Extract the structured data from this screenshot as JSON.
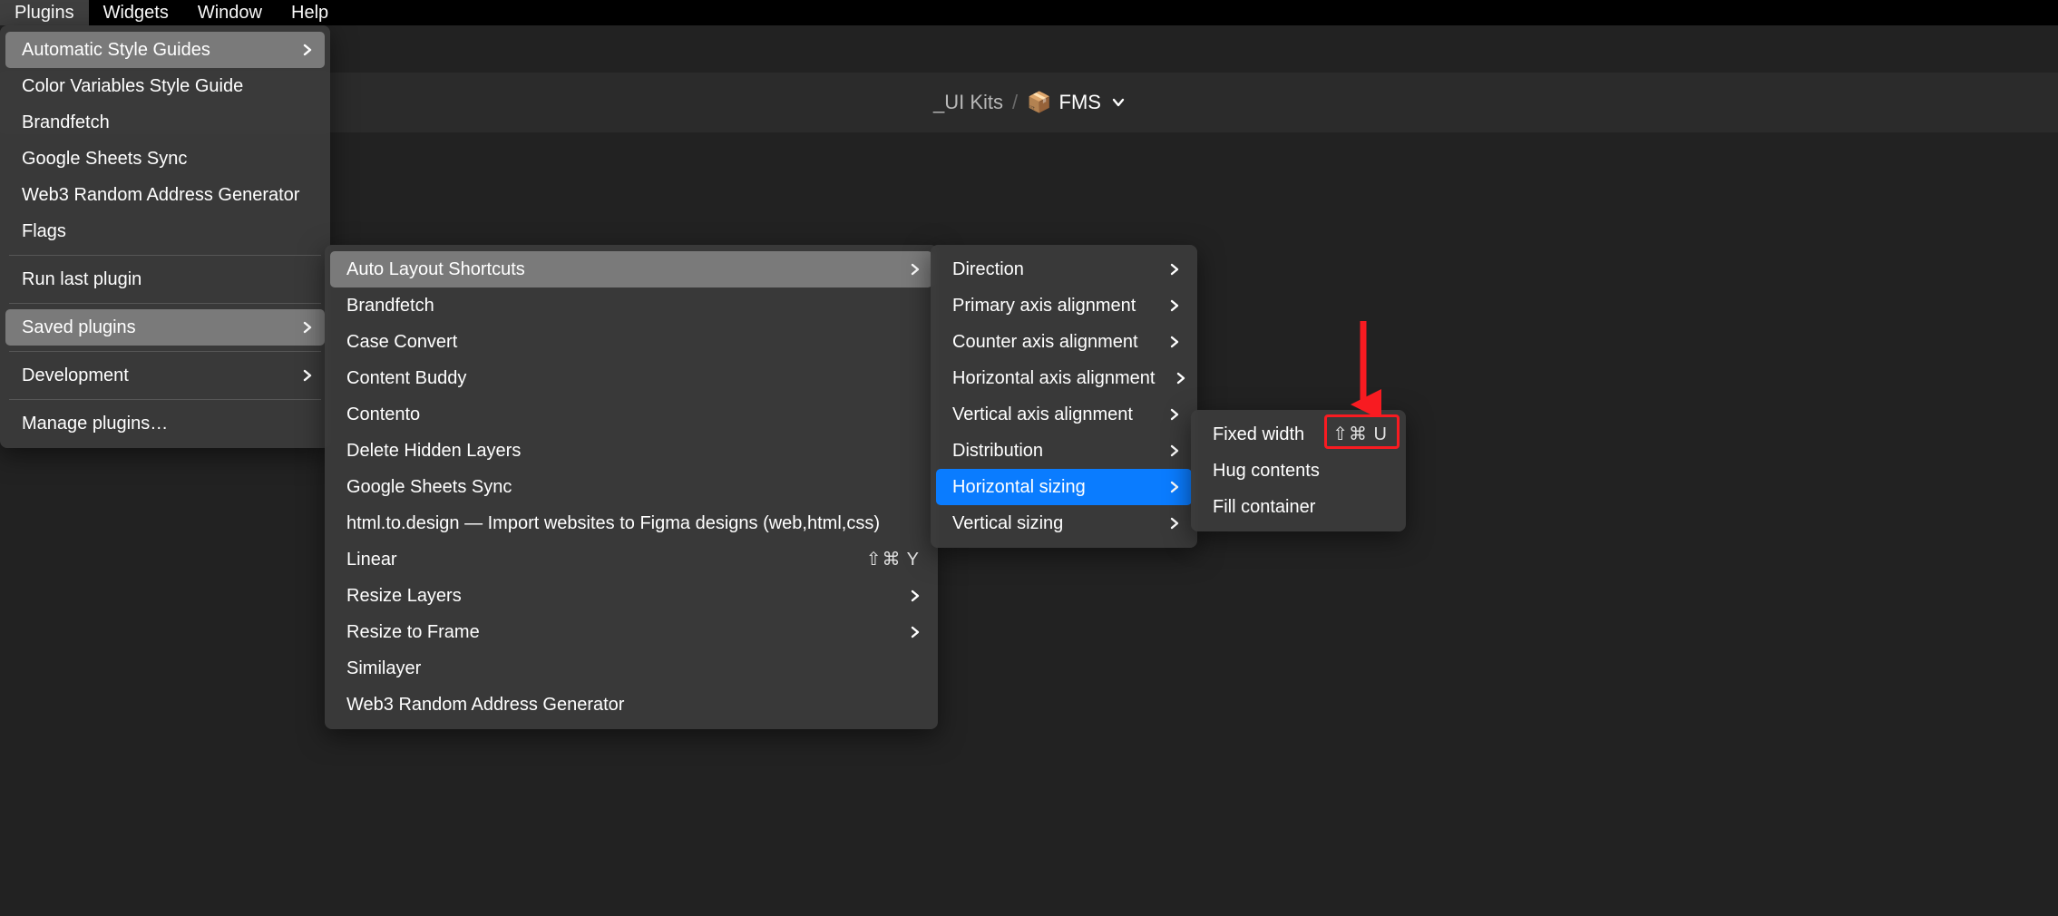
{
  "menubar": {
    "plugins": "Plugins",
    "widgets": "Widgets",
    "window": "Window",
    "help": "Help"
  },
  "breadcrumb": {
    "parent": "_UI Kits",
    "sep": "/",
    "emoji": "📦",
    "name": "FMS"
  },
  "plugins_menu": {
    "items": [
      "Automatic Style Guides",
      "Color Variables Style Guide",
      "Brandfetch",
      "Google Sheets Sync",
      "Web3 Random Address Generator",
      "Flags"
    ],
    "run_last": "Run last plugin",
    "saved": "Saved plugins",
    "development": "Development",
    "manage": "Manage plugins…"
  },
  "saved_menu": {
    "items": [
      "Auto Layout Shortcuts",
      "Brandfetch",
      "Case Convert",
      "Content Buddy",
      "Contento",
      "Delete Hidden Layers",
      "Google Sheets Sync",
      "html.to.design — Import websites to Figma designs (web,html,css)",
      "Linear",
      "Resize Layers",
      "Resize to Frame",
      "Similayer",
      "Web3 Random Address Generator"
    ],
    "linear_shortcut": "⇧⌘ Y"
  },
  "als_menu": {
    "items": [
      "Direction",
      "Primary axis alignment",
      "Counter axis alignment",
      "Horizontal axis alignment",
      "Vertical axis alignment",
      "Distribution",
      "Horizontal sizing",
      "Vertical sizing"
    ]
  },
  "horiz_menu": {
    "fixed": "Fixed width",
    "fixed_shortcut": "⇧⌘ U",
    "hug": "Hug contents",
    "fill": "Fill container"
  }
}
